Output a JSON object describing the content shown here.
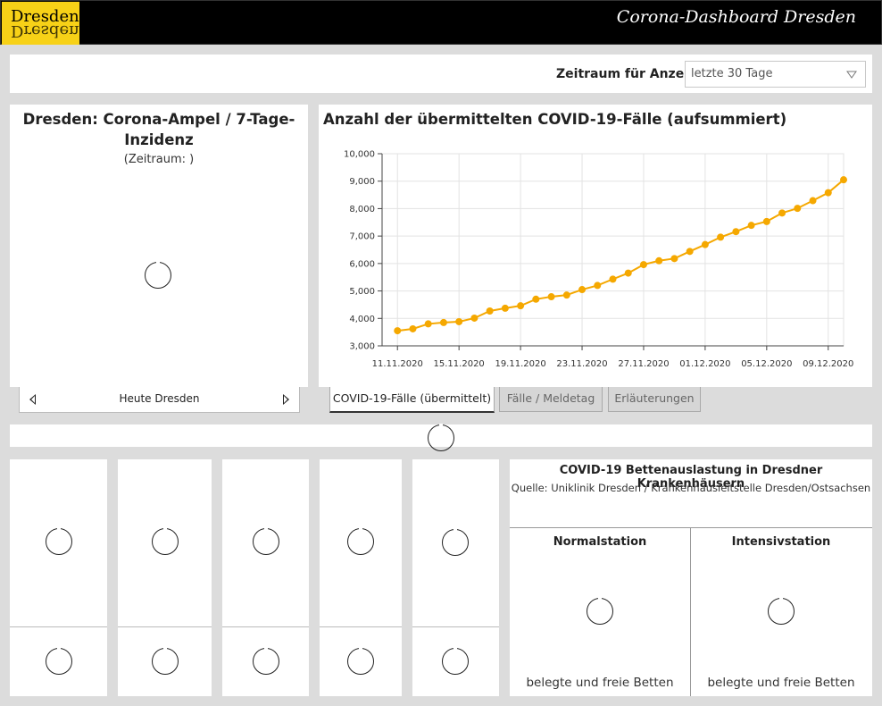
{
  "header": {
    "logo_text": "Dresden.",
    "title": "Corona-Dashboard Dresden"
  },
  "filter": {
    "label": "Zeitraum für Anzeige:",
    "selected": "letzte 30 Tage"
  },
  "ampel": {
    "title": "Dresden: Corona-Ampel / 7-Tage-Inzidenz",
    "subtitle": "(Zeitraum: )",
    "nav_label": "Heute Dresden"
  },
  "cases_chart": {
    "title": "Anzahl der übermittelten COVID-19-Fälle (aufsummiert)",
    "tabs": [
      {
        "label": "COVID-19-Fälle (übermittelt)",
        "active": true
      },
      {
        "label": "Fälle / Meldetag",
        "active": false
      },
      {
        "label": "Erläuterungen",
        "active": false
      }
    ]
  },
  "chart_data": {
    "type": "line",
    "title": "Anzahl der übermittelten COVID-19-Fälle (aufsummiert)",
    "xlabel": "",
    "ylabel": "",
    "ylim": [
      3000,
      10000
    ],
    "yticks": [
      "3,000",
      "4,000",
      "5,000",
      "6,000",
      "7,000",
      "8,000",
      "9,000",
      "10,000"
    ],
    "xtick_labels": [
      "11.11.2020",
      "15.11.2020",
      "19.11.2020",
      "23.11.2020",
      "27.11.2020",
      "01.12.2020",
      "05.12.2020",
      "09.12.2020"
    ],
    "x": [
      "10.11.2020",
      "11.11.2020",
      "12.11.2020",
      "13.11.2020",
      "14.11.2020",
      "15.11.2020",
      "16.11.2020",
      "17.11.2020",
      "18.11.2020",
      "19.11.2020",
      "20.11.2020",
      "21.11.2020",
      "22.11.2020",
      "23.11.2020",
      "24.11.2020",
      "25.11.2020",
      "26.11.2020",
      "27.11.2020",
      "28.11.2020",
      "29.11.2020",
      "30.11.2020",
      "01.12.2020",
      "02.12.2020",
      "03.12.2020",
      "04.12.2020",
      "05.12.2020",
      "06.12.2020",
      "07.12.2020",
      "08.12.2020",
      "09.12.2020",
      "10.12.2020"
    ],
    "series": [
      {
        "values": [
          3550,
          3620,
          3800,
          3850,
          3880,
          4010,
          4270,
          4370,
          4460,
          4700,
          4790,
          4850,
          5050,
          5200,
          5430,
          5650,
          5960,
          6100,
          6180,
          6440,
          6690,
          6960,
          7160,
          7390,
          7530,
          7840,
          8010,
          8290,
          8580,
          9050
        ],
        "color": "#f5a800"
      }
    ],
    "grid": true,
    "legend": "none"
  },
  "beds": {
    "title": "COVID-19 Bettenauslastung in Dresdner Krankenhäusern",
    "source": "Quelle: Uniklinik Dresden / Krankenhausleitstelle Dresden/Ostsachsen",
    "columns": [
      {
        "title": "Normalstation",
        "footer": "belegte und freie Betten"
      },
      {
        "title": "Intensivstation",
        "footer": "belegte und freie Betten"
      }
    ]
  },
  "colors": {
    "brand_yellow": "#f7d117",
    "header_bg": "#000000",
    "line_color": "#f5a800"
  }
}
